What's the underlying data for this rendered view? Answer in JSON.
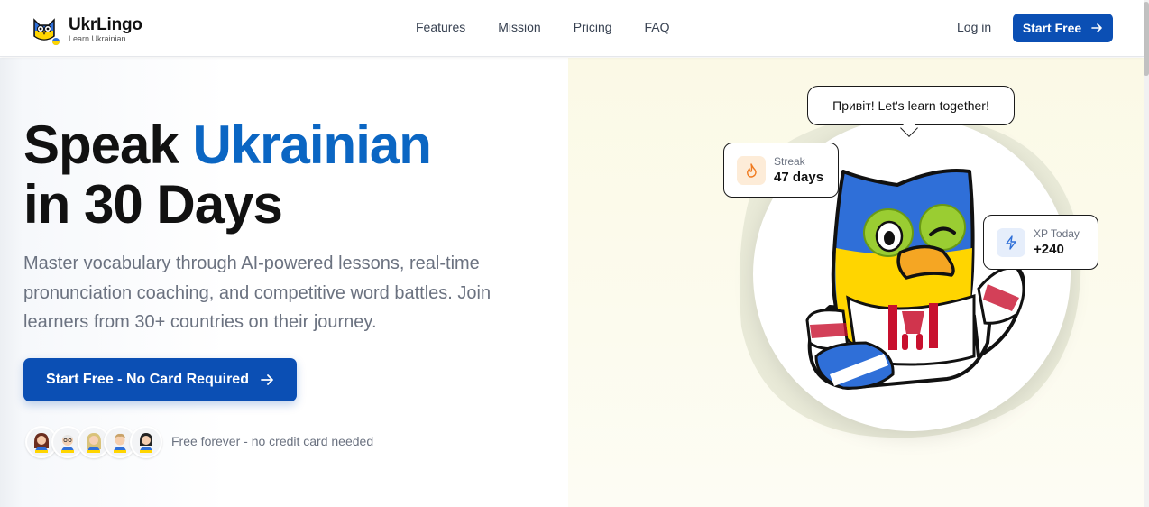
{
  "brand": {
    "name": "UkrLingo",
    "tagline": "Learn Ukrainian"
  },
  "nav": {
    "links": [
      "Features",
      "Mission",
      "Pricing",
      "FAQ"
    ],
    "login": "Log in",
    "cta": "Start Free"
  },
  "hero": {
    "title_part1": "Speak ",
    "title_accent": "Ukrainian",
    "title_line2": "in 30 Days",
    "description": "Master vocabulary through AI-powered lessons, real-time pronunciation coaching, and competitive word battles. Join learners from 30+ countries on their journey.",
    "cta": "Start Free - No Card Required",
    "social_note": "Free forever - no credit card needed",
    "avatar_count": 5
  },
  "illustration": {
    "speech_bubble": "Привіт! Let's learn together!",
    "streak": {
      "label": "Streak",
      "value": "47 days",
      "icon": "flame-icon"
    },
    "xp": {
      "label": "XP Today",
      "value": "+240",
      "icon": "lightning-icon"
    }
  },
  "colors": {
    "primary": "#0b4fb4",
    "accent_text": "#0b66c3",
    "ukraine_blue": "#2f6fd8",
    "ukraine_yellow": "#ffd500"
  }
}
